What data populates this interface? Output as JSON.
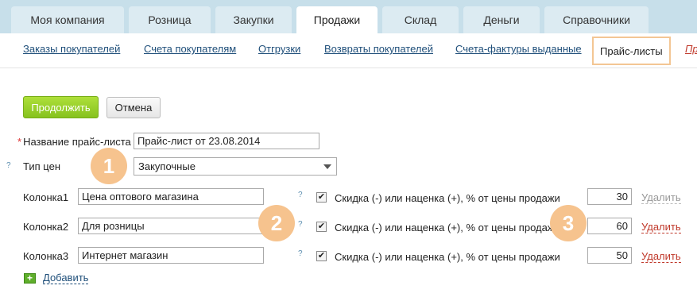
{
  "top_tabs": [
    {
      "label": "Моя компания",
      "active": false
    },
    {
      "label": "Розница",
      "active": false
    },
    {
      "label": "Закупки",
      "active": false
    },
    {
      "label": "Продажи",
      "active": true
    },
    {
      "label": "Склад",
      "active": false
    },
    {
      "label": "Деньги",
      "active": false
    },
    {
      "label": "Справочники",
      "active": false
    }
  ],
  "sub_nav": [
    {
      "label": "Заказы покупателей",
      "active": false
    },
    {
      "label": "Счета покупателям",
      "active": false
    },
    {
      "label": "Отгрузки",
      "active": false
    },
    {
      "label": "Возвраты покупателей",
      "active": false
    },
    {
      "label": "Счета-фактуры выданные",
      "active": false
    },
    {
      "label": "Прайс-листы",
      "active": true
    },
    {
      "label": "Пр",
      "active": false
    }
  ],
  "buttons": {
    "continue": "Продолжить",
    "cancel": "Отмена"
  },
  "form": {
    "name_label": "Название прайс-листа",
    "required_mark": "*",
    "name_value": "Прайс-лист от 23.08.2014",
    "price_type_label": "Тип цен",
    "price_type_value": "Закупочные",
    "help_glyph": "?",
    "columns": [
      {
        "label": "Колонка1",
        "value": "Цена оптового магазина",
        "checked": true,
        "discount_label": "Скидка (-) или наценка (+), % от цены продажи",
        "percent": "30",
        "delete_label": "Удалить",
        "delete_active": false
      },
      {
        "label": "Колонка2",
        "value": "Для розницы",
        "checked": true,
        "discount_label": "Скидка (-) или наценка (+), % от цены продажи",
        "percent": "60",
        "delete_label": "Удалить",
        "delete_active": true
      },
      {
        "label": "Колонка3",
        "value": "Интернет магазин",
        "checked": true,
        "discount_label": "Скидка (-) или наценка (+), % от цены продажи",
        "percent": "50",
        "delete_label": "Удалить",
        "delete_active": true
      }
    ],
    "add_label": "Добавить"
  },
  "markers": [
    "1",
    "2",
    "3"
  ],
  "colors": {
    "accent_green": "#86c21e",
    "active_outline": "#f3c694",
    "link_blue": "#1f4f7a",
    "marker": "#f6c38e",
    "delete_red": "#c0392b"
  },
  "icons": {
    "help": "question-mark-icon",
    "add": "plus-square-icon",
    "dropdown": "chevron-down-icon",
    "checkbox": "checkmark-icon"
  }
}
